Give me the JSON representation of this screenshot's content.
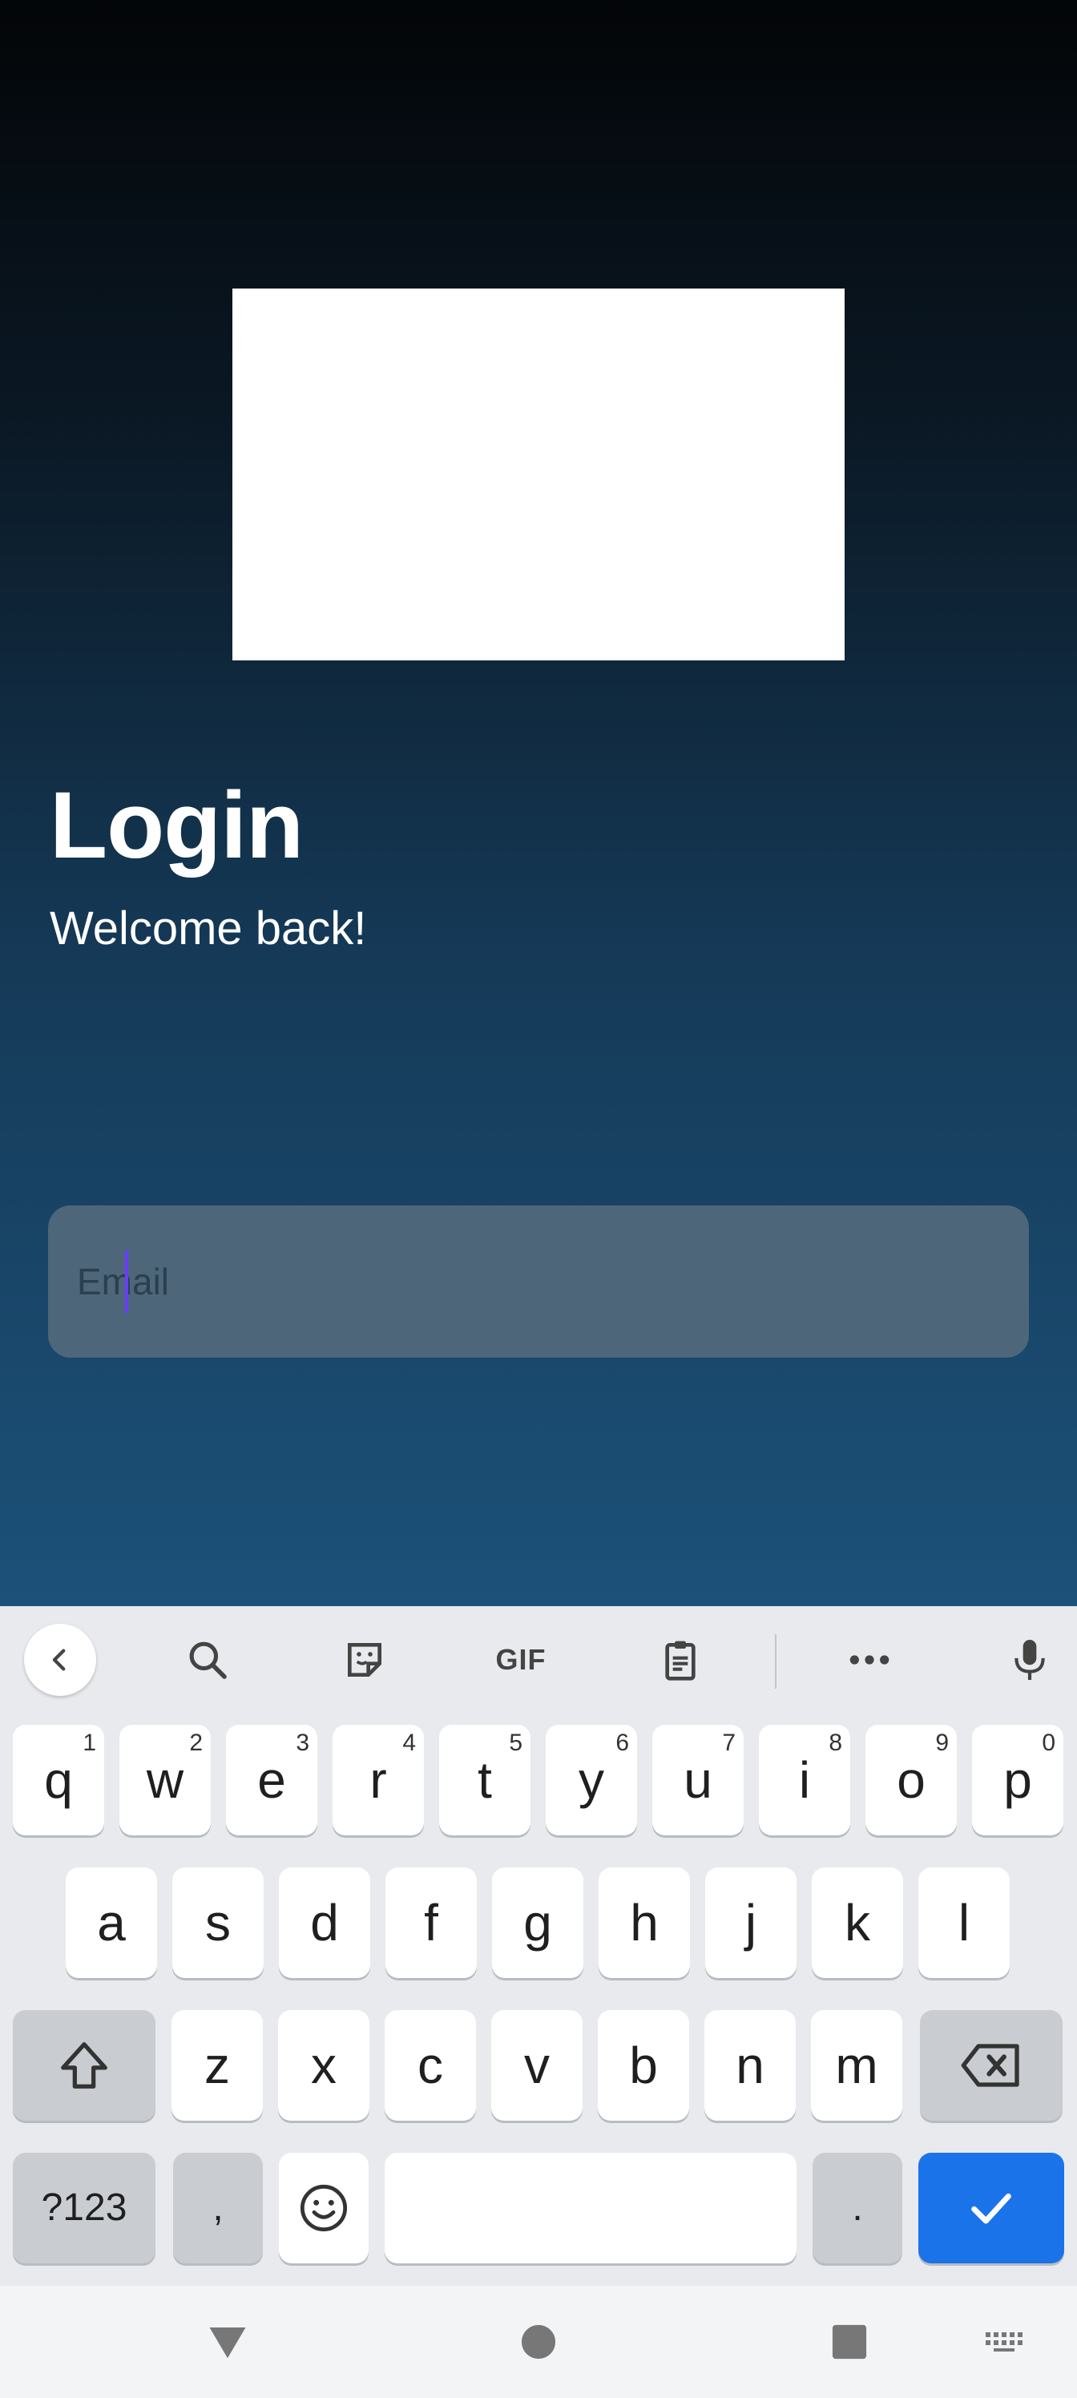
{
  "login": {
    "title": "Login",
    "subtitle": "Welcome back!",
    "email_placeholder": "Email",
    "email_value": ""
  },
  "keyboard": {
    "toolbar": {
      "gif_label": "GIF"
    },
    "row1": [
      {
        "key": "q",
        "num": "1"
      },
      {
        "key": "w",
        "num": "2"
      },
      {
        "key": "e",
        "num": "3"
      },
      {
        "key": "r",
        "num": "4"
      },
      {
        "key": "t",
        "num": "5"
      },
      {
        "key": "y",
        "num": "6"
      },
      {
        "key": "u",
        "num": "7"
      },
      {
        "key": "i",
        "num": "8"
      },
      {
        "key": "o",
        "num": "9"
      },
      {
        "key": "p",
        "num": "0"
      }
    ],
    "row2": [
      "a",
      "s",
      "d",
      "f",
      "g",
      "h",
      "j",
      "k",
      "l"
    ],
    "row3": [
      "z",
      "x",
      "c",
      "v",
      "b",
      "n",
      "m"
    ],
    "symbols_label": "?123",
    "comma_label": ",",
    "period_label": "."
  },
  "colors": {
    "accent": "#1a73e8",
    "cursor": "#6a3cff"
  }
}
